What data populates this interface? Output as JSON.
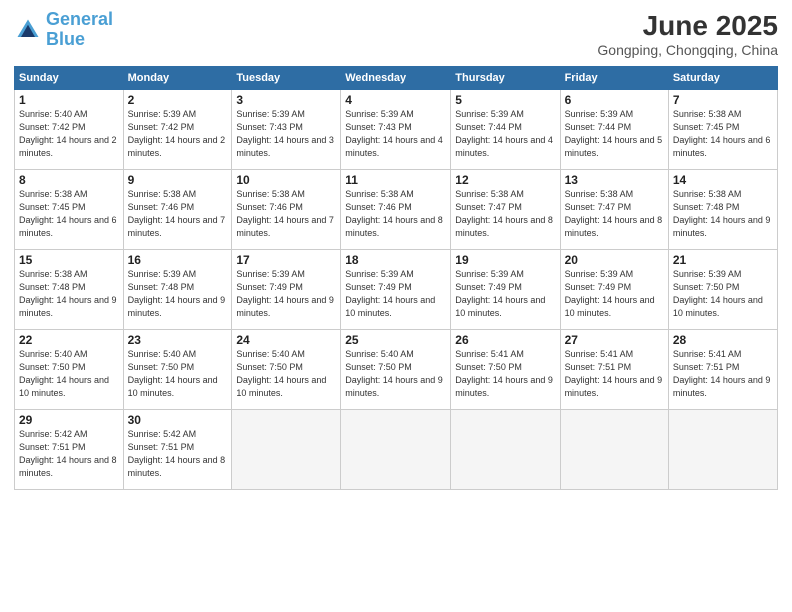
{
  "logo": {
    "line1": "General",
    "line2": "Blue"
  },
  "title": "June 2025",
  "subtitle": "Gongping, Chongqing, China",
  "weekdays": [
    "Sunday",
    "Monday",
    "Tuesday",
    "Wednesday",
    "Thursday",
    "Friday",
    "Saturday"
  ],
  "weeks": [
    [
      {
        "day": "1",
        "sunrise": "Sunrise: 5:40 AM",
        "sunset": "Sunset: 7:42 PM",
        "daylight": "Daylight: 14 hours and 2 minutes."
      },
      {
        "day": "2",
        "sunrise": "Sunrise: 5:39 AM",
        "sunset": "Sunset: 7:42 PM",
        "daylight": "Daylight: 14 hours and 2 minutes."
      },
      {
        "day": "3",
        "sunrise": "Sunrise: 5:39 AM",
        "sunset": "Sunset: 7:43 PM",
        "daylight": "Daylight: 14 hours and 3 minutes."
      },
      {
        "day": "4",
        "sunrise": "Sunrise: 5:39 AM",
        "sunset": "Sunset: 7:43 PM",
        "daylight": "Daylight: 14 hours and 4 minutes."
      },
      {
        "day": "5",
        "sunrise": "Sunrise: 5:39 AM",
        "sunset": "Sunset: 7:44 PM",
        "daylight": "Daylight: 14 hours and 4 minutes."
      },
      {
        "day": "6",
        "sunrise": "Sunrise: 5:39 AM",
        "sunset": "Sunset: 7:44 PM",
        "daylight": "Daylight: 14 hours and 5 minutes."
      },
      {
        "day": "7",
        "sunrise": "Sunrise: 5:38 AM",
        "sunset": "Sunset: 7:45 PM",
        "daylight": "Daylight: 14 hours and 6 minutes."
      }
    ],
    [
      {
        "day": "8",
        "sunrise": "Sunrise: 5:38 AM",
        "sunset": "Sunset: 7:45 PM",
        "daylight": "Daylight: 14 hours and 6 minutes."
      },
      {
        "day": "9",
        "sunrise": "Sunrise: 5:38 AM",
        "sunset": "Sunset: 7:46 PM",
        "daylight": "Daylight: 14 hours and 7 minutes."
      },
      {
        "day": "10",
        "sunrise": "Sunrise: 5:38 AM",
        "sunset": "Sunset: 7:46 PM",
        "daylight": "Daylight: 14 hours and 7 minutes."
      },
      {
        "day": "11",
        "sunrise": "Sunrise: 5:38 AM",
        "sunset": "Sunset: 7:46 PM",
        "daylight": "Daylight: 14 hours and 8 minutes."
      },
      {
        "day": "12",
        "sunrise": "Sunrise: 5:38 AM",
        "sunset": "Sunset: 7:47 PM",
        "daylight": "Daylight: 14 hours and 8 minutes."
      },
      {
        "day": "13",
        "sunrise": "Sunrise: 5:38 AM",
        "sunset": "Sunset: 7:47 PM",
        "daylight": "Daylight: 14 hours and 8 minutes."
      },
      {
        "day": "14",
        "sunrise": "Sunrise: 5:38 AM",
        "sunset": "Sunset: 7:48 PM",
        "daylight": "Daylight: 14 hours and 9 minutes."
      }
    ],
    [
      {
        "day": "15",
        "sunrise": "Sunrise: 5:38 AM",
        "sunset": "Sunset: 7:48 PM",
        "daylight": "Daylight: 14 hours and 9 minutes."
      },
      {
        "day": "16",
        "sunrise": "Sunrise: 5:39 AM",
        "sunset": "Sunset: 7:48 PM",
        "daylight": "Daylight: 14 hours and 9 minutes."
      },
      {
        "day": "17",
        "sunrise": "Sunrise: 5:39 AM",
        "sunset": "Sunset: 7:49 PM",
        "daylight": "Daylight: 14 hours and 9 minutes."
      },
      {
        "day": "18",
        "sunrise": "Sunrise: 5:39 AM",
        "sunset": "Sunset: 7:49 PM",
        "daylight": "Daylight: 14 hours and 10 minutes."
      },
      {
        "day": "19",
        "sunrise": "Sunrise: 5:39 AM",
        "sunset": "Sunset: 7:49 PM",
        "daylight": "Daylight: 14 hours and 10 minutes."
      },
      {
        "day": "20",
        "sunrise": "Sunrise: 5:39 AM",
        "sunset": "Sunset: 7:49 PM",
        "daylight": "Daylight: 14 hours and 10 minutes."
      },
      {
        "day": "21",
        "sunrise": "Sunrise: 5:39 AM",
        "sunset": "Sunset: 7:50 PM",
        "daylight": "Daylight: 14 hours and 10 minutes."
      }
    ],
    [
      {
        "day": "22",
        "sunrise": "Sunrise: 5:40 AM",
        "sunset": "Sunset: 7:50 PM",
        "daylight": "Daylight: 14 hours and 10 minutes."
      },
      {
        "day": "23",
        "sunrise": "Sunrise: 5:40 AM",
        "sunset": "Sunset: 7:50 PM",
        "daylight": "Daylight: 14 hours and 10 minutes."
      },
      {
        "day": "24",
        "sunrise": "Sunrise: 5:40 AM",
        "sunset": "Sunset: 7:50 PM",
        "daylight": "Daylight: 14 hours and 10 minutes."
      },
      {
        "day": "25",
        "sunrise": "Sunrise: 5:40 AM",
        "sunset": "Sunset: 7:50 PM",
        "daylight": "Daylight: 14 hours and 9 minutes."
      },
      {
        "day": "26",
        "sunrise": "Sunrise: 5:41 AM",
        "sunset": "Sunset: 7:50 PM",
        "daylight": "Daylight: 14 hours and 9 minutes."
      },
      {
        "day": "27",
        "sunrise": "Sunrise: 5:41 AM",
        "sunset": "Sunset: 7:51 PM",
        "daylight": "Daylight: 14 hours and 9 minutes."
      },
      {
        "day": "28",
        "sunrise": "Sunrise: 5:41 AM",
        "sunset": "Sunset: 7:51 PM",
        "daylight": "Daylight: 14 hours and 9 minutes."
      }
    ],
    [
      {
        "day": "29",
        "sunrise": "Sunrise: 5:42 AM",
        "sunset": "Sunset: 7:51 PM",
        "daylight": "Daylight: 14 hours and 8 minutes."
      },
      {
        "day": "30",
        "sunrise": "Sunrise: 5:42 AM",
        "sunset": "Sunset: 7:51 PM",
        "daylight": "Daylight: 14 hours and 8 minutes."
      },
      null,
      null,
      null,
      null,
      null
    ]
  ]
}
